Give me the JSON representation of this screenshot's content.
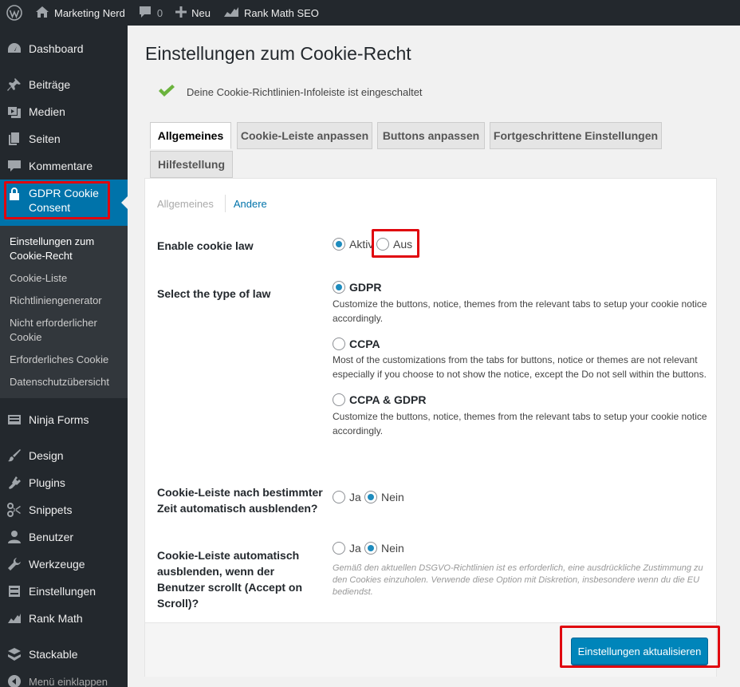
{
  "adminbar": {
    "site_name": "Marketing Nerd",
    "comments_count": "0",
    "new_label": "Neu",
    "seo_label": "Rank Math SEO"
  },
  "sidebar": {
    "items": [
      {
        "label": "Dashboard",
        "icon": "dashboard-icon"
      },
      {
        "label": "Beiträge",
        "icon": "pin-icon"
      },
      {
        "label": "Medien",
        "icon": "media-icon"
      },
      {
        "label": "Seiten",
        "icon": "pages-icon"
      },
      {
        "label": "Kommentare",
        "icon": "comment-icon"
      },
      {
        "label": "GDPR Cookie Consent",
        "icon": "lock-icon"
      },
      {
        "label": "Ninja Forms",
        "icon": "forms-icon"
      },
      {
        "label": "Design",
        "icon": "brush-icon"
      },
      {
        "label": "Plugins",
        "icon": "plugin-icon"
      },
      {
        "label": "Snippets",
        "icon": "scissors-icon"
      },
      {
        "label": "Benutzer",
        "icon": "user-icon"
      },
      {
        "label": "Werkzeuge",
        "icon": "wrench-icon"
      },
      {
        "label": "Einstellungen",
        "icon": "settings-icon"
      },
      {
        "label": "Rank Math",
        "icon": "chart-icon"
      },
      {
        "label": "Stackable",
        "icon": "stackable-icon"
      },
      {
        "label": "Menü einklappen",
        "icon": "collapse-icon"
      }
    ],
    "submenu": [
      "Einstellungen zum Cookie-Recht",
      "Cookie-Liste",
      "Richtliniengenerator",
      "Nicht erforderlicher Cookie",
      "Erforderliches Cookie",
      "Datenschutzübersicht"
    ]
  },
  "page": {
    "title": "Einstellungen zum Cookie-Recht",
    "notice": "Deine Cookie-Richtlinien-Infoleiste ist eingeschaltet"
  },
  "tabs": [
    "Allgemeines",
    "Cookie-Leiste anpassen",
    "Buttons anpassen",
    "Fortgeschrittene Einstellungen",
    "Hilfestellung"
  ],
  "subnav": {
    "current": "Allgemeines",
    "other": "Andere"
  },
  "settings": {
    "enable_label": "Enable cookie law",
    "enable_on": "Aktiv",
    "enable_off": "Aus",
    "law_label": "Select the type of law",
    "laws": [
      {
        "name": "GDPR",
        "desc": "Customize the buttons, notice, themes from the relevant tabs to setup your cookie notice accordingly."
      },
      {
        "name": "CCPA",
        "desc": "Most of the customizations from the tabs for buttons, notice or themes are not relevant especially if you choose to not show the notice, except the Do not sell within the buttons."
      },
      {
        "name": "CCPA & GDPR",
        "desc": "Customize the buttons, notice, themes from the relevant tabs to setup your cookie notice accordingly."
      }
    ],
    "autohide_label": "Cookie-Leiste nach bestimmter Zeit automatisch ausblenden?",
    "scroll_label": "Cookie-Leiste automatisch ausblenden, wenn der Benutzer scrollt (Accept on Scroll)?",
    "yes": "Ja",
    "no": "Nein",
    "scroll_note": "Gemäß den aktuellen DSGVO-Richtlinien ist es erforderlich, eine ausdrückliche Zustimmung zu den Cookies einzuholen. Verwende diese Option mit Diskretion, insbesondere wenn du die EU bediendst.",
    "save_label": "Einstellungen aktualisieren"
  },
  "colors": {
    "accent": "#0073aa",
    "highlight": "#e0060e",
    "success": "#46b450"
  }
}
